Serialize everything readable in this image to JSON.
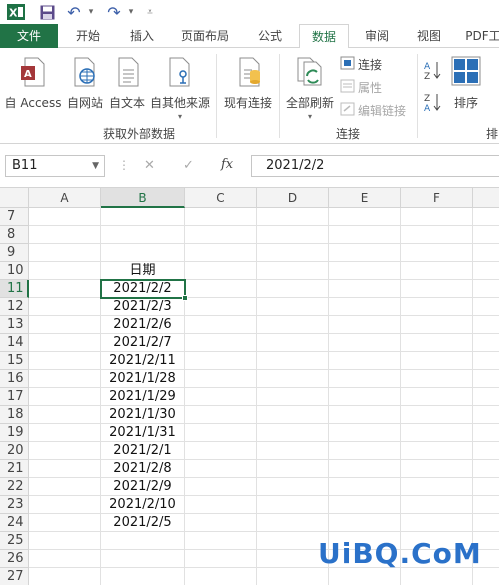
{
  "window": {
    "redo_symbol": "↷",
    "undo_symbol": "↶",
    "more_symbol": "▾"
  },
  "tabs": [
    {
      "label": "文件"
    },
    {
      "label": "开始"
    },
    {
      "label": "插入"
    },
    {
      "label": "页面布局"
    },
    {
      "label": "公式"
    },
    {
      "label": "数据"
    },
    {
      "label": "审阅"
    },
    {
      "label": "视图"
    },
    {
      "label": "PDF工"
    }
  ],
  "ribbon": {
    "get_external": {
      "access": "自 Access",
      "web": "自网站",
      "text": "自文本",
      "other": "自其他来源",
      "group_label": "获取外部数据"
    },
    "existing": "现有连接",
    "refresh_all": "全部刷新",
    "connections": {
      "connections": "连接",
      "properties": "属性",
      "edit_links": "编辑链接",
      "group_label": "连接"
    },
    "sort": {
      "sort": "排序",
      "group_label": "排"
    }
  },
  "formula_bar": {
    "name_box": "B11",
    "cancel": "✕",
    "enter": "✓",
    "fx": "fx",
    "value": "2021/2/2"
  },
  "columns": [
    "A",
    "B",
    "C",
    "D",
    "E",
    "F"
  ],
  "rows": [
    {
      "n": "7",
      "b": ""
    },
    {
      "n": "8",
      "b": ""
    },
    {
      "n": "9",
      "b": ""
    },
    {
      "n": "10",
      "b": "日期"
    },
    {
      "n": "11",
      "b": "2021/2/2"
    },
    {
      "n": "12",
      "b": "2021/2/3"
    },
    {
      "n": "13",
      "b": "2021/2/6"
    },
    {
      "n": "14",
      "b": "2021/2/7"
    },
    {
      "n": "15",
      "b": "2021/2/11"
    },
    {
      "n": "16",
      "b": "2021/1/28"
    },
    {
      "n": "17",
      "b": "2021/1/29"
    },
    {
      "n": "18",
      "b": "2021/1/30"
    },
    {
      "n": "19",
      "b": "2021/1/31"
    },
    {
      "n": "20",
      "b": "2021/2/1"
    },
    {
      "n": "21",
      "b": "2021/2/8"
    },
    {
      "n": "22",
      "b": "2021/2/9"
    },
    {
      "n": "23",
      "b": "2021/2/10"
    },
    {
      "n": "24",
      "b": "2021/2/5"
    },
    {
      "n": "25",
      "b": ""
    },
    {
      "n": "26",
      "b": ""
    },
    {
      "n": "27",
      "b": ""
    }
  ],
  "watermark": "UiBQ.CoM",
  "colors": {
    "accent": "#217346",
    "watermark": "#2a71c9"
  }
}
